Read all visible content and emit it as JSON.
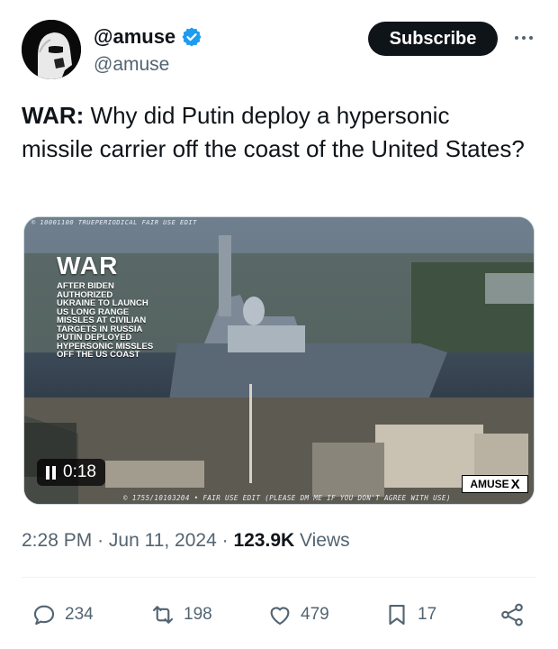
{
  "author": {
    "display_name": "@amuse",
    "handle": "@amuse",
    "verified": true
  },
  "header": {
    "subscribe_label": "Subscribe",
    "more_icon": "more-horizontal-icon"
  },
  "tweet": {
    "lead": "WAR:",
    "body": " Why did Putin deploy a hypersonic missile carrier off the coast of the United States?"
  },
  "media": {
    "top_caption": "© 10001100 TRUEPERIODICAL FAIR USE EDIT",
    "title": "WAR",
    "lines": [
      "AFTER BIDEN",
      "AUTHORIZED",
      "UKRAINE TO LAUNCH",
      "US LONG RANGE",
      "MISSLES AT CIVILIAN",
      "TARGETS IN RUSSIA",
      "PUTIN DEPLOYED",
      "HYPERSONIC MISSLES",
      "OFF THE US COAST"
    ],
    "timer": "0:18",
    "bottom_credit": "© 1755/10103204 • FAIR USE EDIT (PLEASE DM ME IF YOU DON'T AGREE WITH USE)",
    "watermark": "AMUSE",
    "watermark_x": "X"
  },
  "meta": {
    "time": "2:28 PM",
    "date": "Jun 11, 2024",
    "views_count": "123.9K",
    "views_label": "Views"
  },
  "actions": {
    "replies": "234",
    "reposts": "198",
    "likes": "479",
    "bookmarks": "17"
  },
  "colors": {
    "text": "#0f1419",
    "secondary": "#536471",
    "verified": "#1d9bf0",
    "button_bg": "#0f1419"
  }
}
